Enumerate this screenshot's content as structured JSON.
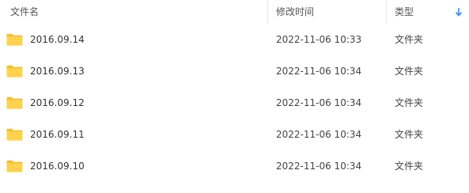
{
  "header": {
    "name_label": "文件名",
    "mtime_label": "修改时间",
    "type_label": "类型",
    "sort_icon": "sort-down-arrow-icon"
  },
  "colors": {
    "folder_yellow": "#FFD24D",
    "folder_tab": "#F5BF2E",
    "sort_blue": "#2F8CFF"
  },
  "rows": [
    {
      "name": "2016.09.14",
      "mtime": "2022-11-06 10:33",
      "type": "文件夹",
      "icon": "folder-icon"
    },
    {
      "name": "2016.09.13",
      "mtime": "2022-11-06 10:34",
      "type": "文件夹",
      "icon": "folder-icon"
    },
    {
      "name": "2016.09.12",
      "mtime": "2022-11-06 10:34",
      "type": "文件夹",
      "icon": "folder-icon"
    },
    {
      "name": "2016.09.11",
      "mtime": "2022-11-06 10:34",
      "type": "文件夹",
      "icon": "folder-icon"
    },
    {
      "name": "2016.09.10",
      "mtime": "2022-11-06 10:34",
      "type": "文件夹",
      "icon": "folder-icon"
    }
  ]
}
